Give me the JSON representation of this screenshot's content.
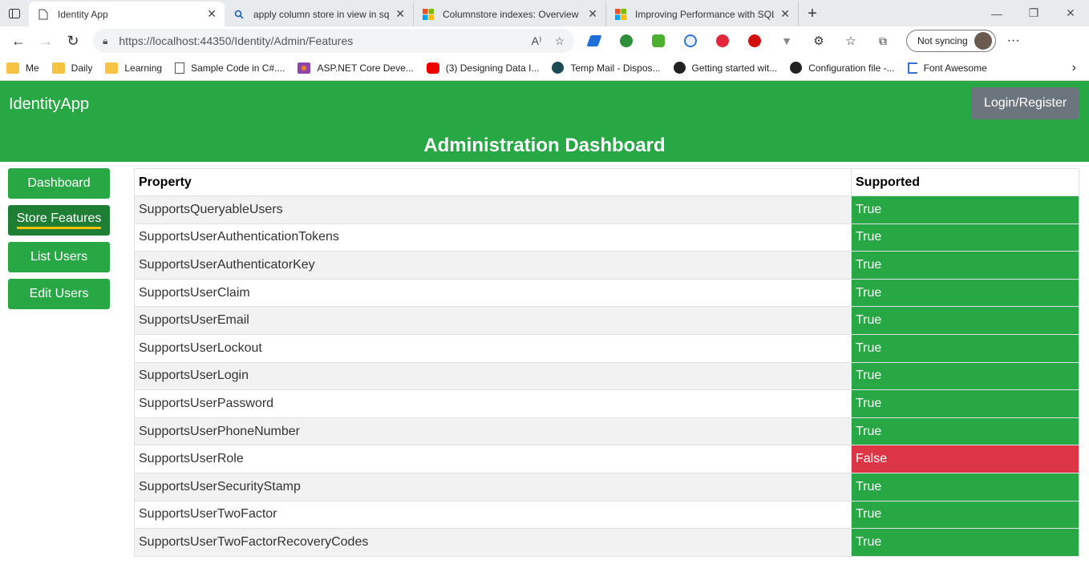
{
  "browser": {
    "tabs": [
      {
        "title": "Identity App",
        "active": true,
        "icon": "page-icon"
      },
      {
        "title": "apply column store in view in sql",
        "active": false,
        "icon": "search-icon"
      },
      {
        "title": "Columnstore indexes: Overview -",
        "active": false,
        "icon": "microsoft-icon"
      },
      {
        "title": "Improving Performance with SQL",
        "active": false,
        "icon": "microsoft-icon"
      }
    ],
    "url": "https://localhost:44350/Identity/Admin/Features",
    "sync_label": "Not syncing",
    "bookmarks": [
      {
        "label": "Me",
        "icon": "folder-icon"
      },
      {
        "label": "Daily",
        "icon": "folder-icon"
      },
      {
        "label": "Learning",
        "icon": "folder-icon"
      },
      {
        "label": "Sample Code in C#....",
        "icon": "page-icon"
      },
      {
        "label": "ASP.NET Core Deve...",
        "icon": "grid-icon"
      },
      {
        "label": "(3) Designing Data I...",
        "icon": "youtube-icon"
      },
      {
        "label": "Temp Mail - Dispos...",
        "icon": "tempmail-icon"
      },
      {
        "label": "Getting started wit...",
        "icon": "github-icon"
      },
      {
        "label": "Configuration file -...",
        "icon": "github-icon"
      },
      {
        "label": "Font Awesome",
        "icon": "flag-icon"
      }
    ]
  },
  "app": {
    "brand": "IdentityApp",
    "login_label": "Login/Register",
    "dashboard_title": "Administration Dashboard",
    "sidebar": [
      {
        "label": "Dashboard",
        "active": false
      },
      {
        "label": "Store Features",
        "active": true
      },
      {
        "label": "List Users",
        "active": false
      },
      {
        "label": "Edit Users",
        "active": false
      }
    ],
    "table": {
      "headers": [
        "Property",
        "Supported"
      ],
      "rows": [
        {
          "property": "SupportsQueryableUsers",
          "supported": "True"
        },
        {
          "property": "SupportsUserAuthenticationTokens",
          "supported": "True"
        },
        {
          "property": "SupportsUserAuthenticatorKey",
          "supported": "True"
        },
        {
          "property": "SupportsUserClaim",
          "supported": "True"
        },
        {
          "property": "SupportsUserEmail",
          "supported": "True"
        },
        {
          "property": "SupportsUserLockout",
          "supported": "True"
        },
        {
          "property": "SupportsUserLogin",
          "supported": "True"
        },
        {
          "property": "SupportsUserPassword",
          "supported": "True"
        },
        {
          "property": "SupportsUserPhoneNumber",
          "supported": "True"
        },
        {
          "property": "SupportsUserRole",
          "supported": "False"
        },
        {
          "property": "SupportsUserSecurityStamp",
          "supported": "True"
        },
        {
          "property": "SupportsUserTwoFactor",
          "supported": "True"
        },
        {
          "property": "SupportsUserTwoFactorRecoveryCodes",
          "supported": "True"
        }
      ]
    },
    "colors": {
      "primary": "#28a745",
      "active": "#1e7e34",
      "danger": "#dc3545",
      "secondary": "#6c757d",
      "underline": "#ffc107"
    }
  }
}
